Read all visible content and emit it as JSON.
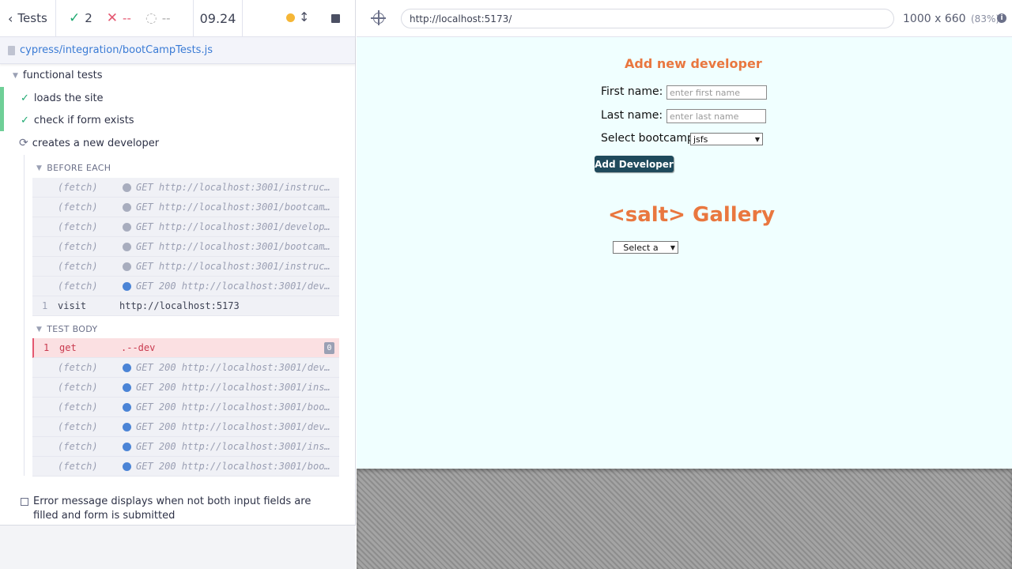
{
  "topbar": {
    "tests_label": "Tests",
    "passed": "2",
    "failed": "--",
    "pending": "--",
    "duration": "09.24"
  },
  "spec": {
    "path": "cypress/integration/bootCampTests.js"
  },
  "suite": {
    "title": "functional tests",
    "tests": [
      {
        "title": "loads the site",
        "state": "passed"
      },
      {
        "title": "check if form exists",
        "state": "passed"
      },
      {
        "title": "creates a new developer",
        "state": "running"
      }
    ],
    "before_each_label": "BEFORE EACH",
    "before_each_cmds": [
      {
        "name": "(fetch)",
        "text": "GET http://localhost:3001/instruc…",
        "dot": "grey"
      },
      {
        "name": "(fetch)",
        "text": "GET http://localhost:3001/bootcam…",
        "dot": "grey"
      },
      {
        "name": "(fetch)",
        "text": "GET http://localhost:3001/develop…",
        "dot": "grey"
      },
      {
        "name": "(fetch)",
        "text": "GET http://localhost:3001/bootcam…",
        "dot": "grey"
      },
      {
        "name": "(fetch)",
        "text": "GET http://localhost:3001/instruc…",
        "dot": "grey"
      },
      {
        "name": "(fetch)",
        "text": "GET 200 http://localhost:3001/dev…",
        "dot": "blue"
      }
    ],
    "visit_cmd": {
      "num": "1",
      "name": "visit",
      "text": "http://localhost:5173"
    },
    "test_body_label": "TEST BODY",
    "get_cmd": {
      "num": "1",
      "name": "get",
      "text": ".--dev",
      "count": "0"
    },
    "body_cmds": [
      {
        "name": "(fetch)",
        "text": "GET 200 http://localhost:3001/dev…",
        "dot": "blue"
      },
      {
        "name": "(fetch)",
        "text": "GET 200 http://localhost:3001/ins…",
        "dot": "blue"
      },
      {
        "name": "(fetch)",
        "text": "GET 200 http://localhost:3001/boo…",
        "dot": "blue"
      },
      {
        "name": "(fetch)",
        "text": "GET 200 http://localhost:3001/dev…",
        "dot": "blue"
      },
      {
        "name": "(fetch)",
        "text": "GET 200 http://localhost:3001/ins…",
        "dot": "blue"
      },
      {
        "name": "(fetch)",
        "text": "GET 200 http://localhost:3001/boo…",
        "dot": "blue"
      }
    ],
    "pending_test": "Error message displays when not both input fields are filled and form is submitted"
  },
  "runner": {
    "url": "http://localhost:5173/",
    "viewport": "1000 x 660",
    "scale": "(83%)"
  },
  "app": {
    "title": "Add new developer",
    "first_name_label": "First name:",
    "first_name_placeholder": "enter first name",
    "last_name_label": "Last name:",
    "last_name_placeholder": "enter last name",
    "bootcamp_label": "Select bootcamp",
    "bootcamp_value": "jsfs",
    "add_button": "Add Developer",
    "gallery_title": "<salt> Gallery",
    "gallery_select": "Select a"
  },
  "colors": {
    "accent_orange": "#e9773f",
    "button_dark": "#1f4a5c",
    "pass_green": "#1fa971",
    "fail_red": "#e45770",
    "link_blue": "#3a7bd5"
  }
}
